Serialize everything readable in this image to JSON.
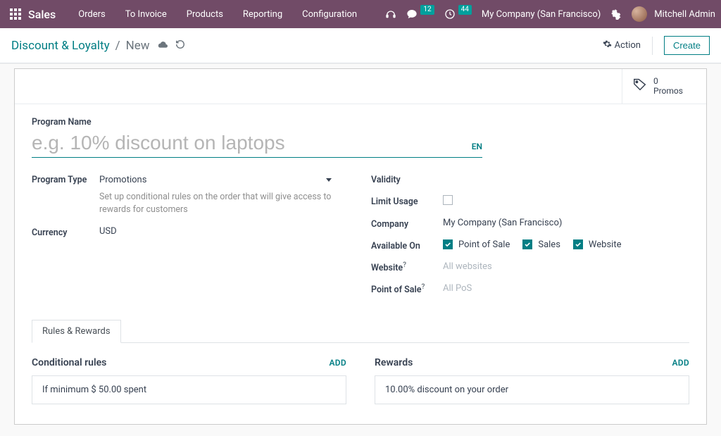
{
  "topbar": {
    "brand": "Sales",
    "nav": [
      "Orders",
      "To Invoice",
      "Products",
      "Reporting",
      "Configuration"
    ],
    "messages_badge": "12",
    "activities_badge": "44",
    "company": "My Company (San Francisco)",
    "user": "Mitchell Admin"
  },
  "control": {
    "breadcrumb_root": "Discount & Loyalty",
    "breadcrumb_current": "New",
    "action_label": "Action",
    "create_label": "Create"
  },
  "stat": {
    "count": "0",
    "label": "Promos"
  },
  "form": {
    "program_name_label": "Program Name",
    "program_name_placeholder": "e.g. 10% discount on laptops",
    "program_name_value": "",
    "lang_tag": "EN",
    "program_type_label": "Program Type",
    "program_type_value": "Promotions",
    "program_type_help": "Set up conditional rules on the order that will give access to rewards for customers",
    "currency_label": "Currency",
    "currency_value": "USD",
    "validity_label": "Validity",
    "validity_value": "",
    "limit_usage_label": "Limit Usage",
    "company_label": "Company",
    "company_value": "My Company (San Francisco)",
    "available_on_label": "Available On",
    "avail_pos": "Point of Sale",
    "avail_sales": "Sales",
    "avail_web": "Website",
    "website_label": "Website",
    "website_value": "All websites",
    "pos_label": "Point of Sale",
    "pos_value": "All PoS",
    "help_mark": "?"
  },
  "tabs": {
    "rules_rewards": "Rules & Rewards",
    "rules_title": "Conditional rules",
    "rewards_title": "Rewards",
    "add": "ADD",
    "rule_card": "If minimum $ 50.00 spent",
    "reward_card": "10.00% discount on your order"
  }
}
